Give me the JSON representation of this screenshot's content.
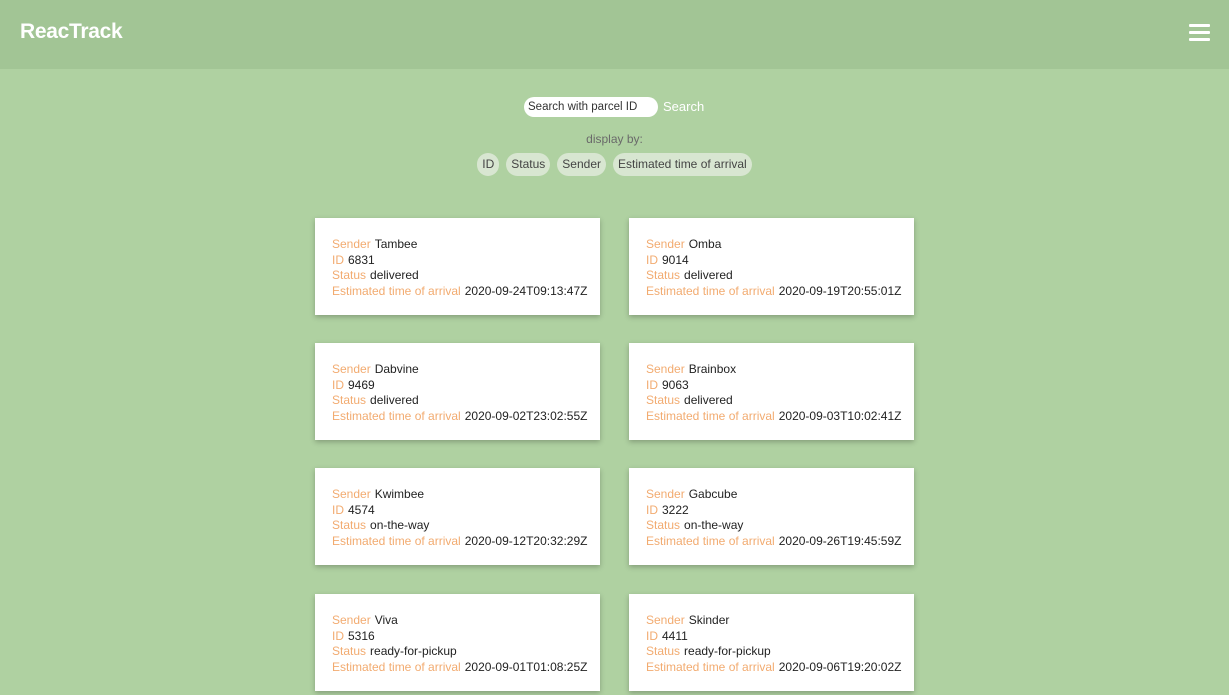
{
  "header": {
    "brand": "ReacTrack",
    "menu_icon": "hamburger-menu-icon"
  },
  "search": {
    "placeholder": "Search with parcel ID",
    "value": "",
    "button_label": "Search"
  },
  "display_by": {
    "label": "display by:",
    "options": [
      "ID",
      "Status",
      "Sender",
      "Estimated time of arrival"
    ]
  },
  "field_labels": {
    "sender": "Sender",
    "id": "ID",
    "status": "Status",
    "eta": "Estimated time of arrival"
  },
  "parcels": [
    {
      "sender": "Tambee",
      "id": "6831",
      "status": "delivered",
      "eta": "2020-09-24T09:13:47Z"
    },
    {
      "sender": "Omba",
      "id": "9014",
      "status": "delivered",
      "eta": "2020-09-19T20:55:01Z"
    },
    {
      "sender": "Dabvine",
      "id": "9469",
      "status": "delivered",
      "eta": "2020-09-02T23:02:55Z"
    },
    {
      "sender": "Brainbox",
      "id": "9063",
      "status": "delivered",
      "eta": "2020-09-03T10:02:41Z"
    },
    {
      "sender": "Kwimbee",
      "id": "4574",
      "status": "on-the-way",
      "eta": "2020-09-12T20:32:29Z"
    },
    {
      "sender": "Gabcube",
      "id": "3222",
      "status": "on-the-way",
      "eta": "2020-09-26T19:45:59Z"
    },
    {
      "sender": "Viva",
      "id": "5316",
      "status": "ready-for-pickup",
      "eta": "2020-09-01T01:08:25Z"
    },
    {
      "sender": "Skinder",
      "id": "4411",
      "status": "ready-for-pickup",
      "eta": "2020-09-06T19:20:02Z"
    }
  ],
  "colors": {
    "background": "#afd1a1",
    "header": "#a2c595",
    "label_accent": "#f2ab70"
  }
}
